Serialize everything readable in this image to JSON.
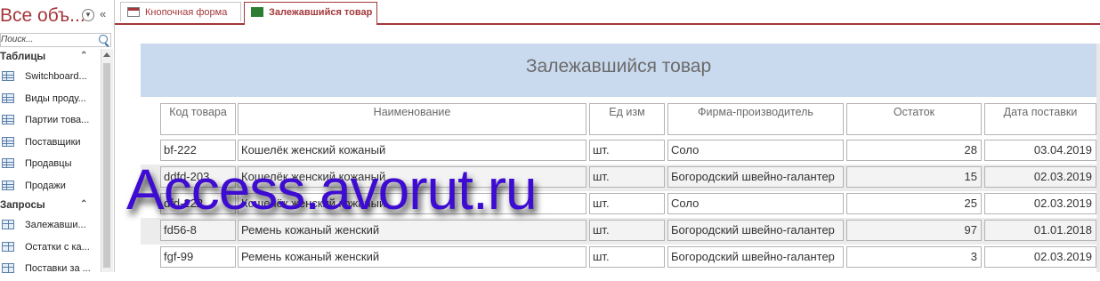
{
  "nav": {
    "title": "Все объ...",
    "search_placeholder": "Поиск...",
    "groups": [
      {
        "label": "Таблицы",
        "items": [
          "Switchboard...",
          "Виды проду...",
          "Партии това...",
          "Поставщики",
          "Продавцы",
          "Продажи"
        ]
      },
      {
        "label": "Запросы",
        "items": [
          "Залежавши...",
          "Остатки с ка...",
          "Поставки за ..."
        ]
      }
    ]
  },
  "tabs": [
    {
      "label": "Кнопочная форма"
    },
    {
      "label": "Залежавшийся товар"
    }
  ],
  "form": {
    "title": "Залежавшийся товар",
    "columns": [
      "Код товара",
      "Наименование",
      "Ед изм",
      "Фирма-производитель",
      "Остаток",
      "Дата поставки"
    ],
    "rows": [
      [
        "bf-222",
        "Кошелёк женский кожаный",
        "шт.",
        "Соло",
        "28",
        "03.04.2019"
      ],
      [
        "ddfd-203",
        "Кошелёк женский кожаный",
        "шт.",
        "Богородский швейно-галантер",
        "15",
        "02.03.2019"
      ],
      [
        "dfd-222",
        "Кошелёк женский кожаный",
        "шт.",
        "Соло",
        "25",
        "02.03.2019"
      ],
      [
        "fd56-8",
        "Ремень кожаный женский",
        "шт.",
        "Богородский швейно-галантер",
        "97",
        "01.01.2018"
      ],
      [
        "fgf-99",
        "Ремень кожаный женский",
        "шт.",
        "Богородский швейно-галантер",
        "3",
        "02.03.2019"
      ]
    ]
  },
  "watermark": "Access.avorut.ru",
  "colors": {
    "accent": "#a4373a",
    "header_bg": "#c9d9ee",
    "watermark": "#3d0bd1"
  }
}
